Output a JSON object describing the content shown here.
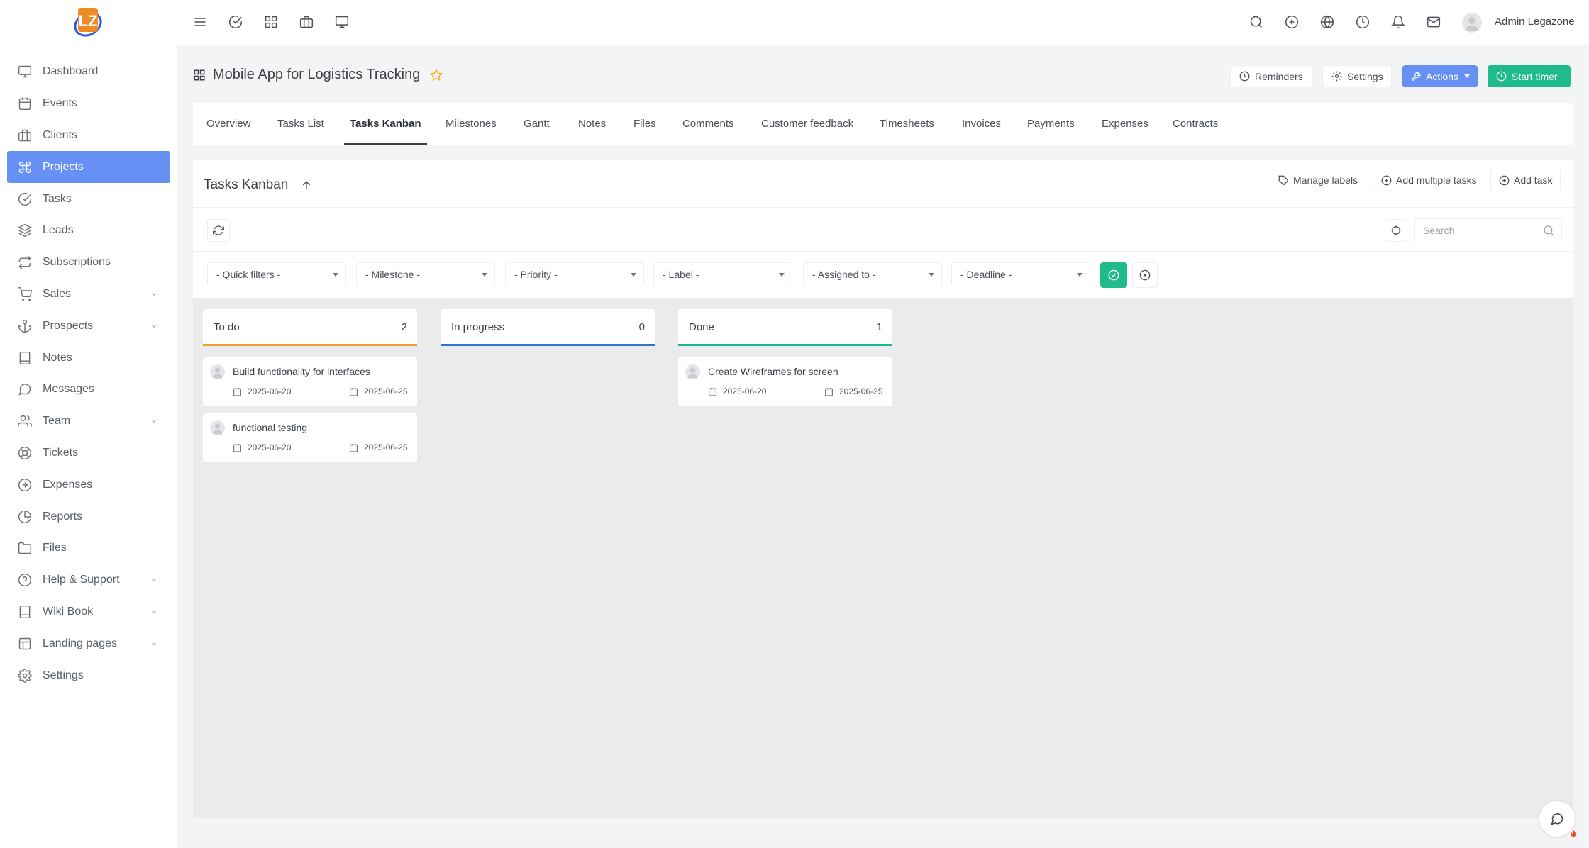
{
  "user": {
    "name": "Admin Legazone"
  },
  "sidebar": {
    "items": [
      {
        "label": "Dashboard",
        "icon": "monitor-icon"
      },
      {
        "label": "Events",
        "icon": "calendar-icon"
      },
      {
        "label": "Clients",
        "icon": "briefcase-icon"
      },
      {
        "label": "Projects",
        "icon": "command-icon",
        "active": true
      },
      {
        "label": "Tasks",
        "icon": "check-circle-icon"
      },
      {
        "label": "Leads",
        "icon": "layers-icon"
      },
      {
        "label": "Subscriptions",
        "icon": "repeat-icon"
      },
      {
        "label": "Sales",
        "icon": "cart-icon",
        "has_children": true
      },
      {
        "label": "Prospects",
        "icon": "anchor-icon",
        "has_children": true
      },
      {
        "label": "Notes",
        "icon": "book-icon"
      },
      {
        "label": "Messages",
        "icon": "message-icon"
      },
      {
        "label": "Team",
        "icon": "users-icon",
        "has_children": true
      },
      {
        "label": "Tickets",
        "icon": "life-buoy-icon"
      },
      {
        "label": "Expenses",
        "icon": "arrow-right-circle-icon"
      },
      {
        "label": "Reports",
        "icon": "pie-chart-icon"
      },
      {
        "label": "Files",
        "icon": "folder-icon"
      },
      {
        "label": "Help & Support",
        "icon": "help-circle-icon",
        "has_children": true
      },
      {
        "label": "Wiki Book",
        "icon": "book-icon",
        "has_children": true
      },
      {
        "label": "Landing pages",
        "icon": "layout-icon",
        "has_children": true
      },
      {
        "label": "Settings",
        "icon": "gear-icon"
      }
    ]
  },
  "header": {
    "title": "Mobile App for Logistics Tracking",
    "reminders_label": "Reminders",
    "settings_label": "Settings",
    "actions_label": "Actions",
    "start_timer_label": "Start timer"
  },
  "tabs": [
    {
      "label": "Overview"
    },
    {
      "label": "Tasks List"
    },
    {
      "label": "Tasks Kanban",
      "active": true
    },
    {
      "label": "Milestones"
    },
    {
      "label": "Gantt"
    },
    {
      "label": "Notes"
    },
    {
      "label": "Files"
    },
    {
      "label": "Comments"
    },
    {
      "label": "Customer feedback"
    },
    {
      "label": "Timesheets"
    },
    {
      "label": "Invoices"
    },
    {
      "label": "Payments"
    },
    {
      "label": "Expenses"
    },
    {
      "label": "Contracts"
    }
  ],
  "kanban": {
    "title": "Tasks Kanban",
    "manage_labels": "Manage labels",
    "add_multiple_tasks": "Add multiple tasks",
    "add_task": "Add task",
    "search_placeholder": "Search",
    "filters": [
      {
        "value": "- Quick filters -"
      },
      {
        "value": "- Milestone -"
      },
      {
        "value": "- Priority -"
      },
      {
        "value": "- Label -"
      },
      {
        "value": "- Assigned to -"
      },
      {
        "value": "- Deadline -"
      }
    ],
    "columns": [
      {
        "name": "To do",
        "count": "2",
        "color": "#f39c34",
        "tasks": [
          {
            "title": "Build functionality for interfaces",
            "start": "2025-06-20",
            "deadline": "2025-06-25"
          },
          {
            "title": "functional testing",
            "start": "2025-06-20",
            "deadline": "2025-06-25"
          }
        ]
      },
      {
        "name": "In progress",
        "count": "0",
        "color": "#2d76c8",
        "tasks": []
      },
      {
        "name": "Done",
        "count": "1",
        "color": "#1cb3a1",
        "tasks": [
          {
            "title": "Create Wireframes for screen",
            "start": "2025-06-20",
            "deadline": "2025-06-25"
          }
        ]
      }
    ]
  },
  "colors": {
    "accent": "#6690f4",
    "success": "#1fbb8a",
    "star": "#f2b429"
  }
}
